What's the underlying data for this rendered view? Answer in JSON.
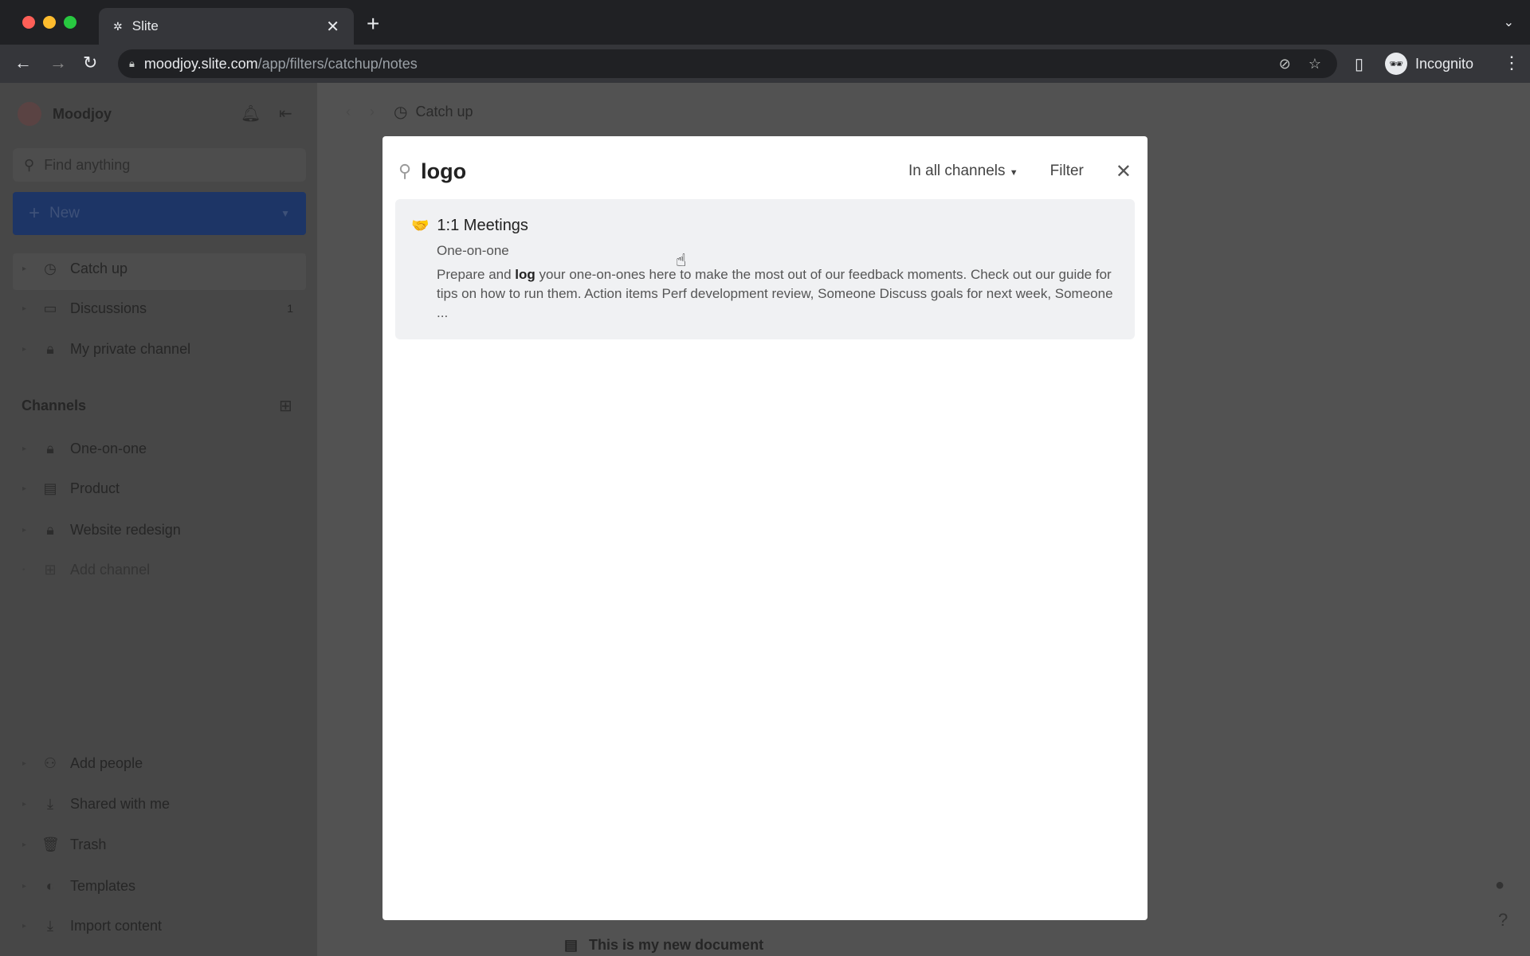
{
  "browser": {
    "tab_title": "Slite",
    "url_host": "moodjoy.slite.com",
    "url_path": "/app/filters/catchup/notes",
    "profile": "Incognito"
  },
  "sidebar": {
    "workspace": "Moodjoy",
    "search_placeholder": "Find anything",
    "new_label": "New",
    "items": [
      {
        "label": "Catch up",
        "icon": "clock-icon"
      },
      {
        "label": "Discussions",
        "icon": "chat-icon",
        "badge": "1"
      },
      {
        "label": "My private channel",
        "icon": "lock-icon"
      }
    ],
    "channels_header": "Channels",
    "channels": [
      {
        "label": "One-on-one",
        "icon": "lock-icon"
      },
      {
        "label": "Product",
        "icon": "doc-icon"
      },
      {
        "label": "Website redesign",
        "icon": "lock-icon"
      },
      {
        "label": "Add channel",
        "icon": "add-channel-icon"
      }
    ],
    "footer": [
      {
        "label": "Add people",
        "icon": "add-person-icon"
      },
      {
        "label": "Shared with me",
        "icon": "inbox-icon"
      },
      {
        "label": "Trash",
        "icon": "trash-icon"
      },
      {
        "label": "Templates",
        "icon": "templates-icon"
      },
      {
        "label": "Import content",
        "icon": "import-icon"
      }
    ]
  },
  "main": {
    "breadcrumb": "Catch up",
    "bottom_doc": "This is my new document"
  },
  "search": {
    "query": "logo",
    "scope": "In all channels",
    "filter_label": "Filter",
    "results": [
      {
        "title": "1:1 Meetings",
        "channel": "One-on-one",
        "snippet_pre": "Prepare and ",
        "snippet_match": "log",
        "snippet_post": " your one-on-ones here to make the most out of our feedback moments. Check out our guide for tips on how to run them. Action items Perf development review, Someone Discuss goals for next week, Someone ..."
      }
    ]
  },
  "colors": {
    "accent": "#1d3566",
    "overlay_bg": "#525252"
  }
}
